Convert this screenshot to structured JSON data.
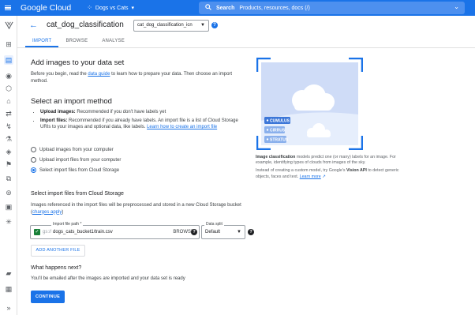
{
  "topbar": {
    "logo_google": "Google",
    "logo_cloud": "Cloud",
    "project_name": "Dogs vs Cats",
    "search_label": "Search",
    "search_placeholder": "Products, resources, docs (/)"
  },
  "header": {
    "title": "cat_dog_classification",
    "model_select": "cat_dog_classification_icn",
    "tabs": [
      "IMPORT",
      "BROWSE",
      "ANALYSE"
    ]
  },
  "import": {
    "heading": "Add images to your data set",
    "intro_before": "Before you begin, read the ",
    "intro_link": "data guide",
    "intro_after": " to learn how to prepare your data. Then choose an import method.",
    "method_heading": "Select an import method",
    "bullet1_bold": "Upload images:",
    "bullet1_text": " Recommended if you don't have labels yet",
    "bullet2_bold": "Import files:",
    "bullet2_text": " Recommended if you already have labels. An import file is a list of Cloud Storage URIs to your images and optional data, like labels. ",
    "bullet2_link": "Learn how to create an import file",
    "options": [
      "Upload images from your computer",
      "Upload import files from your computer",
      "Select import files from Cloud Storage"
    ],
    "storage_heading": "Select import files from Cloud Storage",
    "storage_text": "Images referenced in the import files will be preprocessed and stored in a new Cloud Storage bucket (",
    "storage_link": "charges apply",
    "storage_end": ")",
    "path_label": "Import file path *",
    "path_prefix": "gs://",
    "path_value": "dogs_cats_bucket1/train.csv",
    "browse_label": "BROWSE",
    "split_label": "Data split",
    "split_value": "Default",
    "add_file_label": "ADD ANOTHER FILE",
    "next_heading": "What happens next?",
    "next_text": "You'll be emailed after the images are imported and your data set is ready",
    "continue_label": "CONTINUE"
  },
  "illustration": {
    "tags": [
      "CUMULUS",
      "CIRRUS",
      "STRATUS"
    ]
  },
  "caption": {
    "bold": "Image classification",
    "text": " models predict one (or many) labels for an image. For example, identifying types of clouds from images of the sky.",
    "text2": "Instead of creating a custom model, try Google's ",
    "vision": "Vision API",
    "text3": " to detect generic objects, faces and text. ",
    "learn_more": "Learn more"
  },
  "colors": {
    "brand_blue": "#1a73e8",
    "success_green": "#188038"
  }
}
